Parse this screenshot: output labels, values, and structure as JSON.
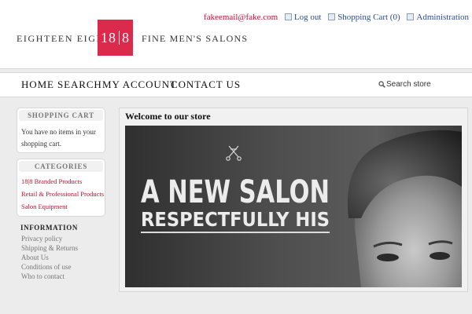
{
  "header": {
    "brand_left": "EIGHTEEN EIGHT",
    "logo_left": "18",
    "logo_right": "8",
    "brand_right": "FINE MEN'S SALONS",
    "email": "fakeemail@fake.com",
    "logout": "Log out",
    "cart": "Shopping Cart (0)",
    "admin": "Administration"
  },
  "nav": {
    "home": "HOME",
    "search": "SEARCH",
    "account": "MY ACCOUNT",
    "contact": "CONTACT US",
    "search_placeholder": "Search store"
  },
  "sidebar": {
    "cart_title": "SHOPPING CART",
    "cart_text": "You have no items in your shopping cart.",
    "categories_title": "CATEGORIES",
    "categories": [
      "18|8 Branded Products",
      "Retail & Professional Products",
      "Salon Equipment"
    ],
    "info_title": "INFORMATION",
    "info_links": [
      "Privacy policy",
      "Shipping & Returns",
      "About Us",
      "Conditions of use",
      "Who to contact"
    ]
  },
  "main": {
    "welcome": "Welcome to our store",
    "banner_line1": "A NEW SALON",
    "banner_line2": "RESPECTFULLY HIS"
  }
}
